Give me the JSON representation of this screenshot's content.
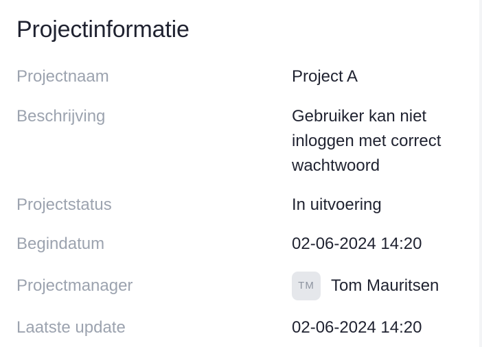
{
  "panel": {
    "title": "Projectinformatie"
  },
  "fields": {
    "project_name": {
      "label": "Projectnaam",
      "value": "Project A"
    },
    "description": {
      "label": "Beschrijving",
      "value": "Gebruiker kan niet inloggen met correct wachtwoord"
    },
    "status": {
      "label": "Projectstatus",
      "value": "In uitvoering"
    },
    "start_date": {
      "label": "Begindatum",
      "value": "02-06-2024 14:20"
    },
    "manager": {
      "label": "Projectmanager",
      "initials": "TM",
      "name": "Tom Mauritsen"
    },
    "last_update": {
      "label": "Laatste update",
      "value": "02-06-2024 14:20"
    }
  },
  "colors": {
    "label": "#9ca3af",
    "value": "#1f2230",
    "avatar_bg": "#e5e7eb"
  }
}
